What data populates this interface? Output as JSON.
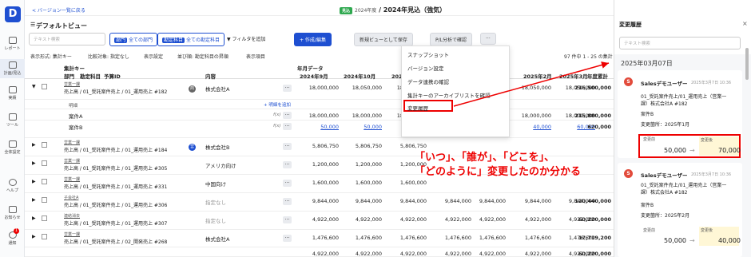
{
  "rail": {
    "logo": "D",
    "items": [
      "レポート",
      "計画/見込",
      "実績",
      "ツール",
      "全体設定"
    ],
    "bottom": [
      "ヘルプ",
      "お知らせ",
      "通知"
    ],
    "notif_badge": "1"
  },
  "topbar": {
    "back": "< バージョン一覧に戻る",
    "tag": "見込",
    "year_sub": "2024年度",
    "title": "/ 2024年見込（強気）"
  },
  "toolbar": {
    "view_title": "デフォルトビュー",
    "search_placeholder": "テキスト検索",
    "chip1_key": "部門",
    "chip1_val": "全ての部門",
    "chip2_key": "勘定科目",
    "chip2_val": "全ての勘定科目",
    "filter": "フィルタを追加",
    "create": "+ 作成/編集",
    "save_new": "新規ビューとして保存",
    "pl_check": "P/L分析で確認",
    "more": "···"
  },
  "options": [
    "表示形式: 集計キー",
    "比較対象: 指定なし",
    "表示設定",
    "並び順: 勘定科目の昇順",
    "表示項目"
  ],
  "pager": "97 件中 1 - 25 の集計",
  "table": {
    "group_header": "集計キー",
    "month_header": "年月データ",
    "cols_left": [
      "部門",
      "勘定科目",
      "予算ID",
      "内容"
    ],
    "months": [
      "2024年9月",
      "2024年10月",
      "2024年11月",
      "2024年12月",
      "2025年1月",
      "2025年2月",
      "2025年3月"
    ],
    "total_header": "年度累計",
    "rows": [
      {
        "dept": "営業一課",
        "sub": "売上高 / 01_受託案件売上 / 01_運用売上 #182",
        "badge": "商",
        "content": "株式会社A",
        "vals": [
          "18,000,000",
          "18,050,000",
          "18,050,000",
          "18,050,000",
          "18,050,000",
          "18,050,000",
          "18,050,000"
        ],
        "total": "216,500,000"
      },
      {
        "dept": "",
        "sub": "",
        "badge": "",
        "content": "明細",
        "vals": [
          "",
          "",
          "",
          "",
          "",
          "",
          ""
        ],
        "total": ""
      },
      {
        "dept": "",
        "sub": "",
        "badge": "",
        "content": "案件A",
        "vals": [
          "18,000,000",
          "18,000,000",
          "18,000,000",
          "18,000,000",
          "18,000,000",
          "18,000,000",
          "18,000,000"
        ],
        "total": "215,880,000"
      },
      {
        "dept": "",
        "sub": "",
        "badge": "",
        "content": "案件B",
        "vals": [
          "50,000",
          "50,000",
          "50,000",
          "50,000",
          "70,000",
          "40,000",
          "60,000"
        ],
        "total": "620,000"
      },
      {
        "dept": "営業一課",
        "sub": "売上高 / 01_受託案件売上 / 01_運用売上 #184",
        "badge": "営",
        "content": "株式会社B",
        "vals": [
          "5,806,750",
          "5,806,750",
          "5,806,750",
          "",
          "",
          "",
          ""
        ],
        "total": ""
      },
      {
        "dept": "営業一課",
        "sub": "売上高 / 01_受託案件売上 / 01_運用売上 #305",
        "badge": "",
        "content": "アメリカ向け",
        "vals": [
          "1,200,000",
          "1,200,000",
          "1,200,000",
          "",
          "",
          "",
          ""
        ],
        "total": ""
      },
      {
        "dept": "営業一課",
        "sub": "売上高 / 01_受託案件売上 / 01_運用売上 #331",
        "badge": "",
        "content": "中国向け",
        "vals": [
          "1,600,000",
          "1,600,000",
          "1,600,000",
          "",
          "",
          "",
          ""
        ],
        "total": ""
      },
      {
        "dept": "子会社A",
        "sub": "売上高 / 01_受託案件売上 / 01_運用売上 #306",
        "badge": "",
        "content": "指定なし",
        "vals": [
          "9,844,000",
          "9,844,000",
          "9,844,000",
          "9,844,000",
          "9,844,000",
          "9,844,000",
          "9,844,000"
        ],
        "total": "120,440,000"
      },
      {
        "dept": "連結消去",
        "sub": "売上高 / 01_受託案件売上 / 01_運用売上 #307",
        "badge": "",
        "content": "指定なし",
        "vals": [
          "4,922,000",
          "4,922,000",
          "4,922,000",
          "4,922,000",
          "4,922,000",
          "4,922,000",
          "4,922,000"
        ],
        "total": "60,220,000"
      },
      {
        "dept": "営業一課",
        "sub": "売上高 / 01_受託案件売上 / 02_開発売上 #268",
        "badge": "",
        "content": "株式会社A",
        "vals": [
          "1,476,600",
          "1,476,600",
          "1,476,600",
          "1,476,600",
          "1,476,600",
          "1,476,600",
          "1,476,600"
        ],
        "total": "17,719,200"
      },
      {
        "dept": "",
        "sub": "",
        "badge": "",
        "content": "",
        "vals": [
          "4,922,000",
          "4,922,000",
          "4,922,000",
          "4,922,000",
          "4,922,000",
          "4,922,000",
          "4,922,000"
        ],
        "total": "60,220,000"
      }
    ],
    "add_detail": "+ 明細を追加",
    "fx": "f(x)"
  },
  "dropdown": {
    "items": [
      "スナップショット",
      "バージョン設定",
      "データ連携の確認",
      "集計キーのアーカイブリストを確認",
      "変更履歴"
    ]
  },
  "annotation": {
    "line1": "「いつ」、「誰が」、「どこを」、",
    "line2": "「どのように」変更したのか分かる"
  },
  "panel": {
    "title": "変更履歴",
    "search_placeholder": "テキスト検索",
    "date": "2025年03月07日",
    "entries": [
      {
        "user": "Salesデモユーザー",
        "time": "2025年3月7日 10:36",
        "desc": "01_受託案件売上/01_運用売上（営業一課）株式会社A #182",
        "item": "案件B",
        "changed": "変更箇所：2025年1月",
        "before_label": "変更前",
        "after_label": "変更後",
        "before": "50,000",
        "after": "70,000"
      },
      {
        "user": "Salesデモユーザー",
        "time": "2025年3月7日 10:36",
        "desc": "01_受託案件売上/01_運用売上（営業一課）株式会社A #182",
        "item": "案件B",
        "changed": "変更箇所：2025年2月",
        "before_label": "変更前",
        "after_label": "変更後",
        "before": "50,000",
        "after": "40,000"
      }
    ]
  },
  "colors": {
    "accent": "#1e4fd1",
    "alert": "#e00000",
    "avatar": "#e24b3b"
  }
}
